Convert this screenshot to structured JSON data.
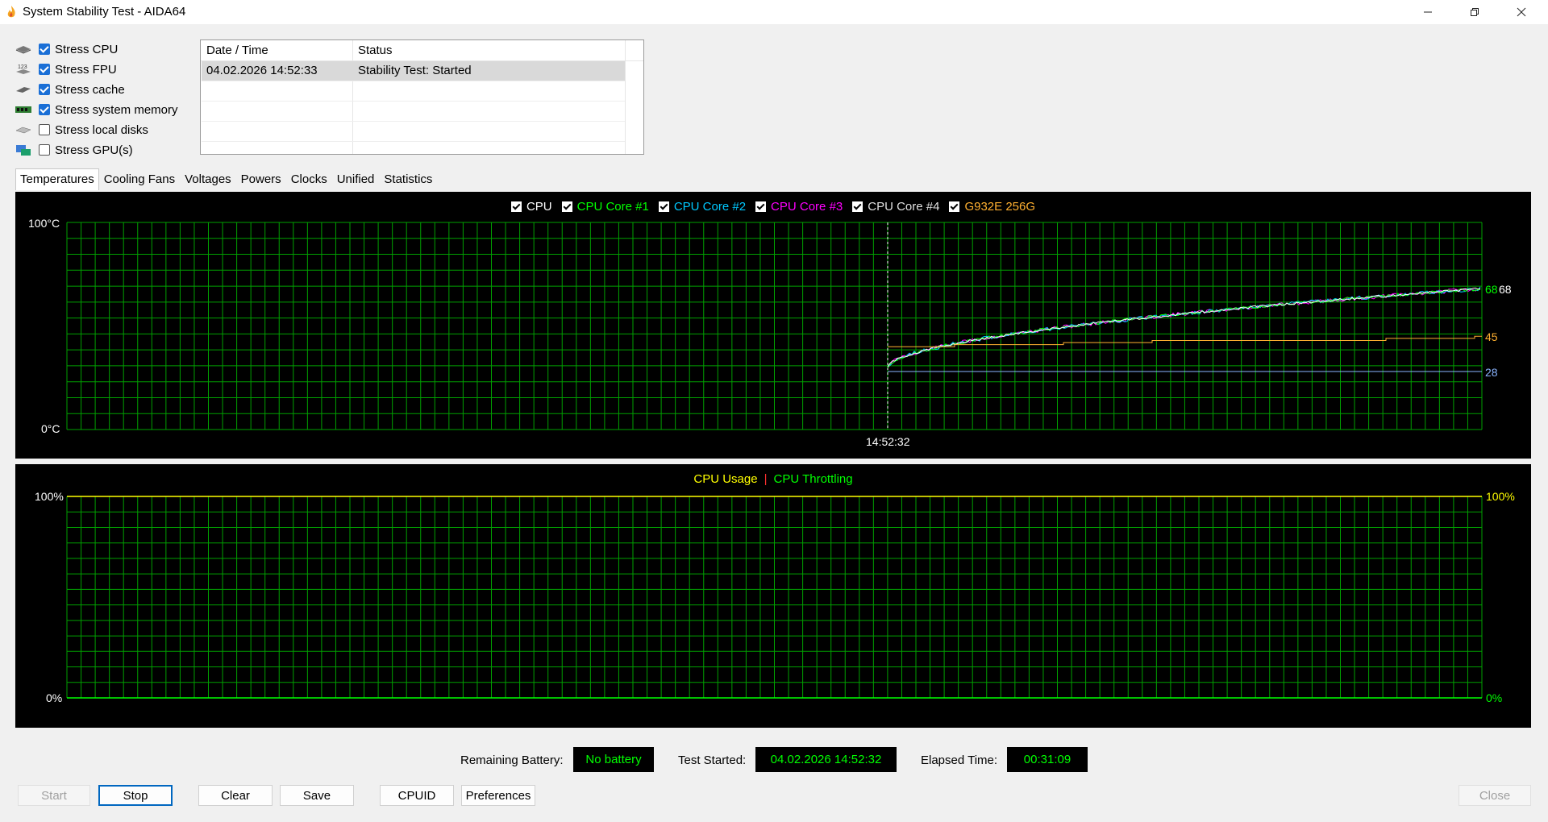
{
  "window": {
    "title": "System Stability Test - AIDA64",
    "icon": "flame-icon",
    "minimize": "minimize-icon",
    "maximize": "restore-icon",
    "close": "close-icon"
  },
  "stress_options": [
    {
      "label": "Stress CPU",
      "checked": true,
      "icon": "cpu-icon"
    },
    {
      "label": "Stress FPU",
      "checked": true,
      "icon": "fpu-icon"
    },
    {
      "label": "Stress cache",
      "checked": true,
      "icon": "cache-icon"
    },
    {
      "label": "Stress system memory",
      "checked": true,
      "icon": "memory-icon"
    },
    {
      "label": "Stress local disks",
      "checked": false,
      "icon": "disk-icon"
    },
    {
      "label": "Stress GPU(s)",
      "checked": false,
      "icon": "gpu-icon"
    }
  ],
  "log": {
    "columns": [
      "Date / Time",
      "Status"
    ],
    "rows": [
      {
        "datetime": "04.02.2026 14:52:33",
        "status": "Stability Test: Started"
      }
    ]
  },
  "tabs": [
    "Temperatures",
    "Cooling Fans",
    "Voltages",
    "Powers",
    "Clocks",
    "Unified",
    "Statistics"
  ],
  "active_tab": "Temperatures",
  "temperature_chart": {
    "legend": [
      {
        "label": "CPU",
        "color": "#ffffff",
        "checked": true
      },
      {
        "label": "CPU Core #1",
        "color": "#00ff00",
        "checked": true
      },
      {
        "label": "CPU Core #2",
        "color": "#00c8ff",
        "checked": true
      },
      {
        "label": "CPU Core #3",
        "color": "#ff00ff",
        "checked": true
      },
      {
        "label": "CPU Core #4",
        "color": "#e0e0e0",
        "checked": true
      },
      {
        "label": "G932E 256G",
        "color": "#ffb030",
        "checked": true
      }
    ],
    "y_top": "100°C",
    "y_bottom": "0°C",
    "marker_time": "14:52:32",
    "end_labels": [
      {
        "text": "68",
        "color": "#00ff00"
      },
      {
        "text": "68",
        "color": "#ffffff"
      },
      {
        "text": "45",
        "color": "#ffb030"
      },
      {
        "text": "28",
        "color": "#8ab4ff"
      }
    ]
  },
  "usage_chart": {
    "legend": [
      {
        "label": "CPU Usage",
        "color": "#ffff00"
      },
      {
        "label": "|",
        "color": "#ff3030"
      },
      {
        "label": "CPU Throttling",
        "color": "#00ff00"
      }
    ],
    "y_top_left": "100%",
    "y_bottom_left": "0%",
    "y_top_right": "100%",
    "y_bottom_right": "0%",
    "colors": {
      "top_right": "#ffff00",
      "bottom_right": "#00ff00"
    }
  },
  "status": {
    "battery_label": "Remaining Battery:",
    "battery_value": "No battery",
    "started_label": "Test Started:",
    "started_value": "04.02.2026 14:52:32",
    "elapsed_label": "Elapsed Time:",
    "elapsed_value": "00:31:09"
  },
  "buttons": {
    "start": "Start",
    "stop": "Stop",
    "clear": "Clear",
    "save": "Save",
    "cpuid": "CPUID",
    "preferences": "Preferences",
    "close": "Close"
  },
  "colors": {
    "grid": "#00a000",
    "panel_bg": "#000000",
    "accent": "#1a6fd6"
  }
}
